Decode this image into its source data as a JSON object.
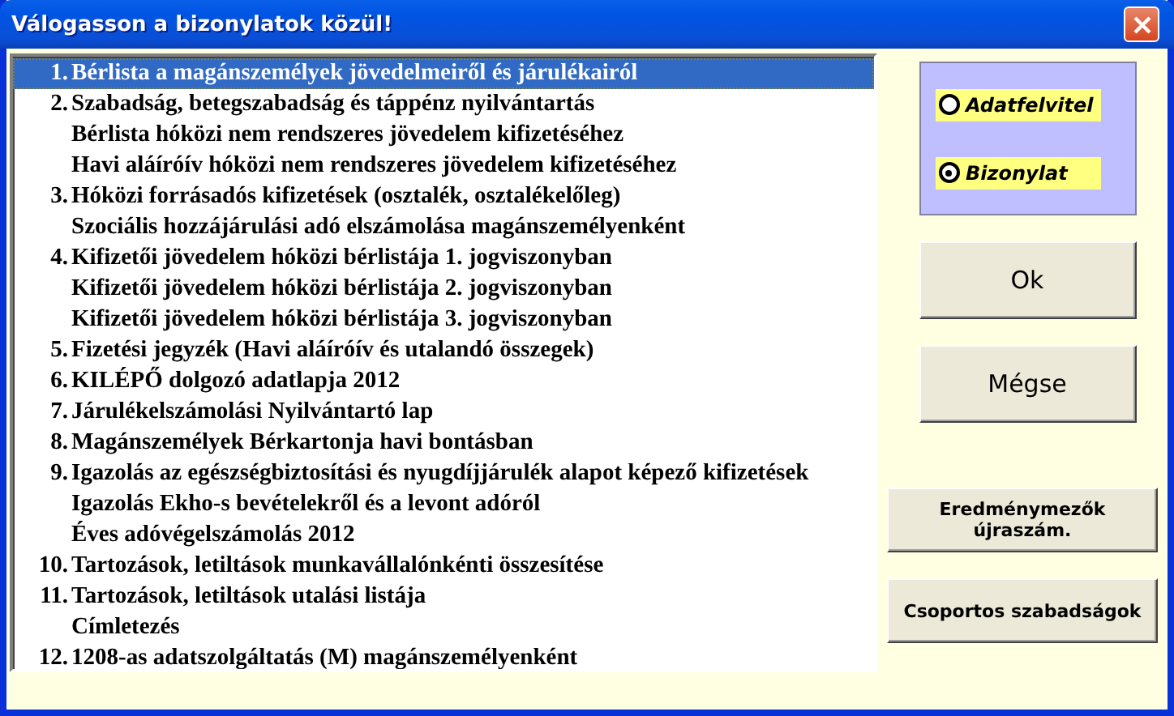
{
  "window": {
    "title": "Válogasson a bizonylatok közül!"
  },
  "list": {
    "items": [
      {
        "number": "1.",
        "label": "Bérlista a magánszemélyek jövedelmeiről és járulékairól",
        "selected": true
      },
      {
        "number": "2.",
        "label": "Szabadság, betegszabadság és táppénz nyilvántartás",
        "selected": false
      },
      {
        "label": "Bérlista hóközi nem rendszeres jövedelem kifizetéséhez",
        "selected": false
      },
      {
        "label": "Havi aláíróív hóközi nem rendszeres jövedelem kifizetéséhez",
        "selected": false
      },
      {
        "number": "3.",
        "label": "Hóközi forrásadós kifizetések (osztalék, osztalékelőleg)",
        "selected": false
      },
      {
        "label": "Szociális hozzájárulási adó elszámolása magánszemélyenként",
        "selected": false
      },
      {
        "number": "4.",
        "label": "Kifizetői jövedelem hóközi bérlistája 1. jogviszonyban",
        "selected": false
      },
      {
        "label": "Kifizetői jövedelem hóközi bérlistája 2. jogviszonyban",
        "selected": false
      },
      {
        "label": "Kifizetői jövedelem hóközi bérlistája 3. jogviszonyban",
        "selected": false
      },
      {
        "number": "5.",
        "label": "Fizetési jegyzék (Havi aláíróív és utalandó összegek)",
        "selected": false
      },
      {
        "number": "6.",
        "label": "KILÉPŐ dolgozó adatlapja 2012",
        "selected": false
      },
      {
        "number": "7.",
        "label": "Járulékelszámolási Nyilvántartó lap",
        "selected": false
      },
      {
        "number": "8.",
        "label": "Magánszemélyek Bérkartonja havi bontásban",
        "selected": false
      },
      {
        "number": "9.",
        "label": "Igazolás az egészségbiztosítási és nyugdíjjárulék alapot képező kifizetések",
        "selected": false
      },
      {
        "label": "Igazolás Ekho-s bevételekről és a levont adóról",
        "selected": false
      },
      {
        "label": "Éves adóvégelszámolás 2012",
        "selected": false
      },
      {
        "number": "10.",
        "label": "Tartozások, letiltások munkavállalónkénti összesítése",
        "selected": false
      },
      {
        "number": "11.",
        "label": "Tartozások, letiltások utalási listája",
        "selected": false
      },
      {
        "label": "Címletezés",
        "selected": false
      },
      {
        "number": "12.",
        "label": "1208-as adatszolgáltatás (M) magánszemélyenként",
        "selected": false
      }
    ]
  },
  "mode": {
    "options": [
      {
        "label": "Adatfelvitel",
        "selected": false
      },
      {
        "label": "Bizonylat",
        "selected": true
      }
    ]
  },
  "buttons": [
    {
      "label": "Ok",
      "kind": "large"
    },
    {
      "label": "Mégse",
      "kind": "large"
    },
    {
      "label": "Eredménymezők újraszám.",
      "kind": "small"
    },
    {
      "label": "Csoportos szabadságok",
      "kind": "small"
    }
  ]
}
